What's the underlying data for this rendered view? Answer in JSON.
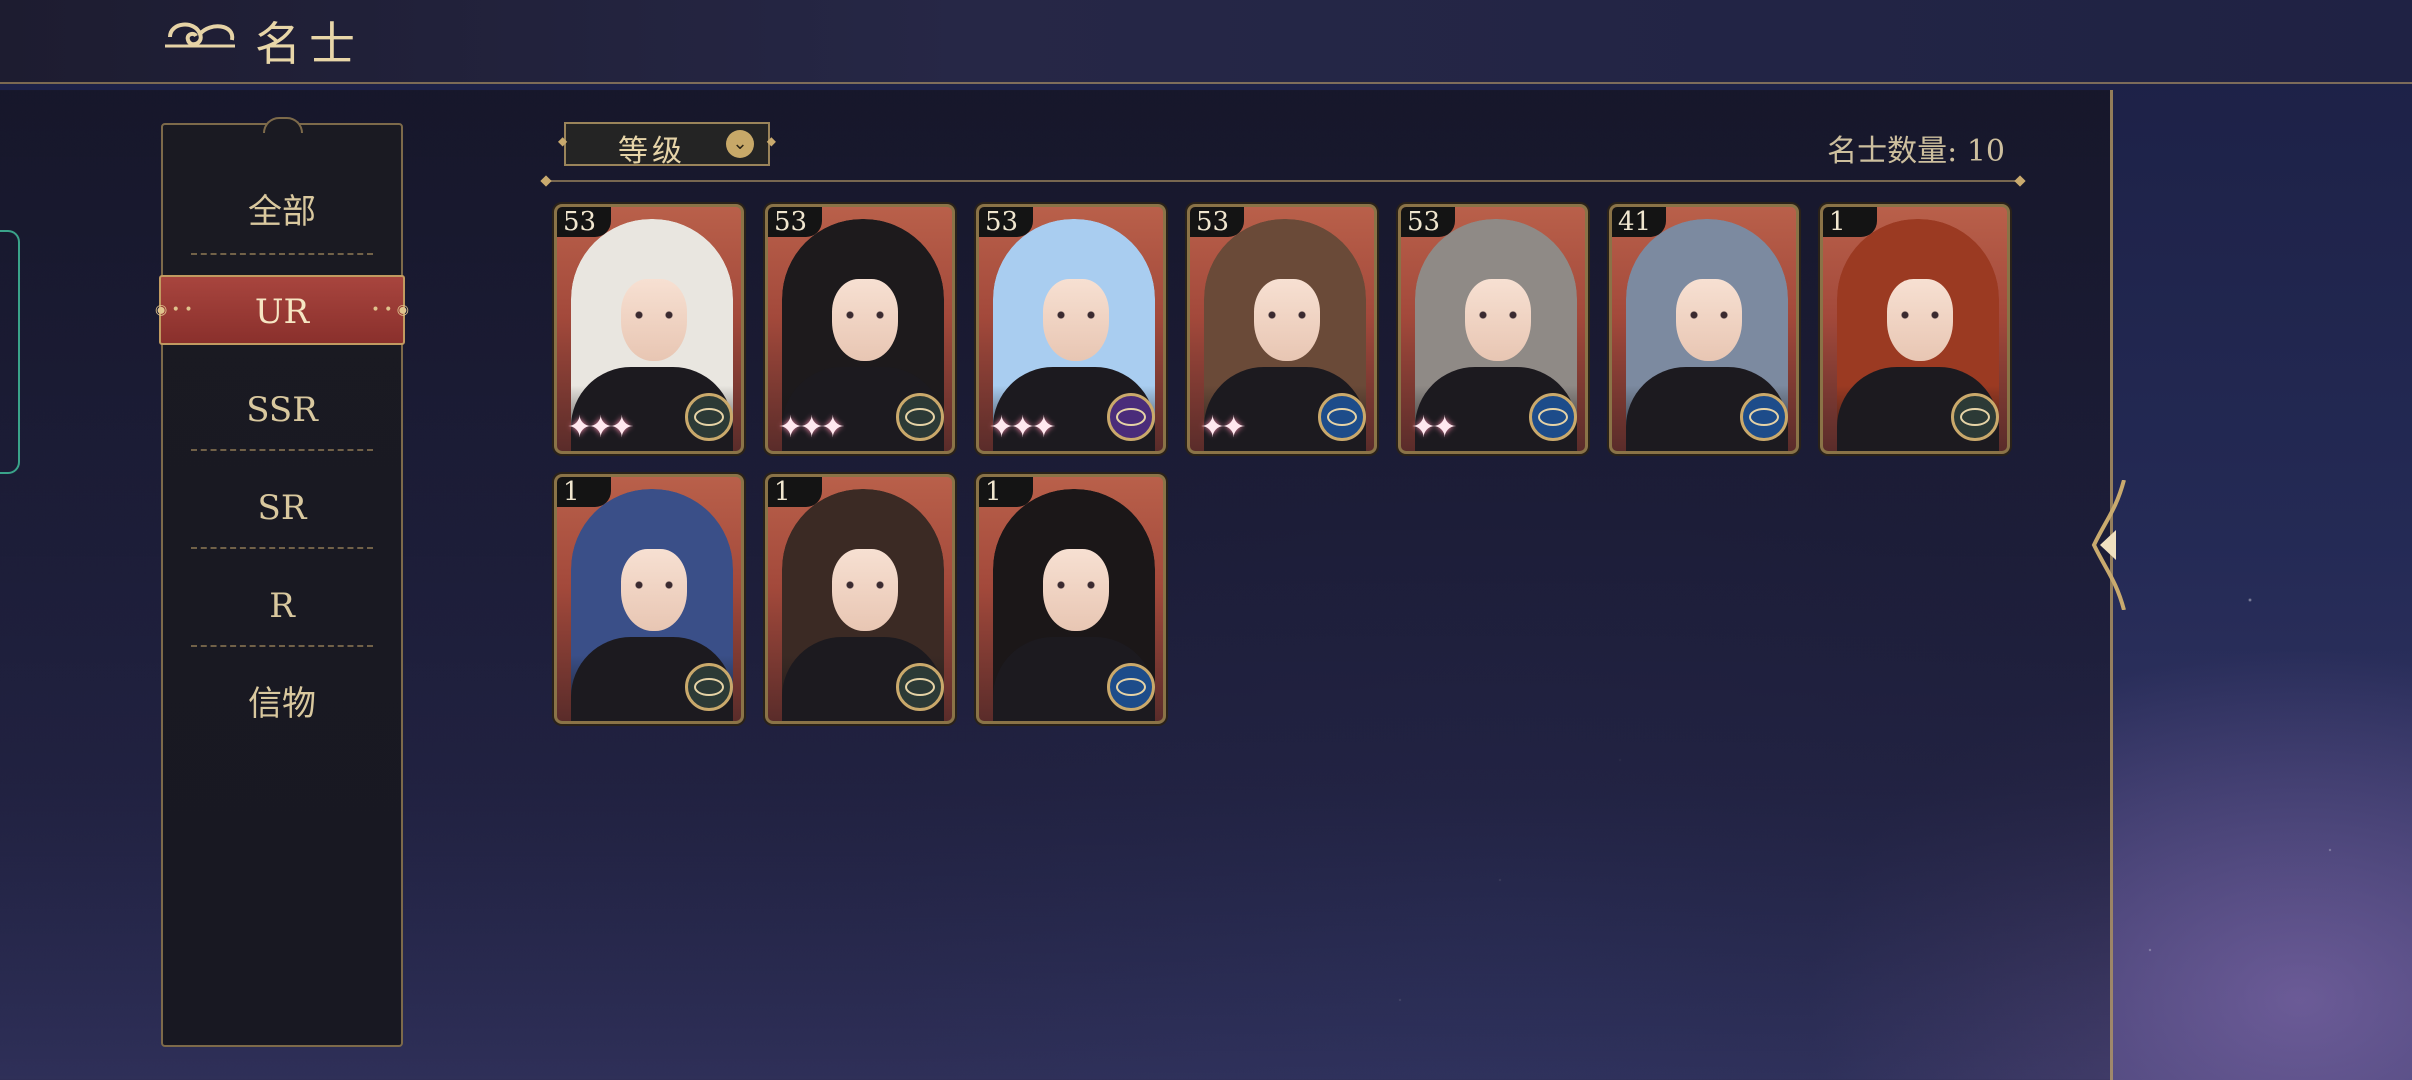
{
  "header": {
    "title": "名士"
  },
  "menu": {
    "items": [
      {
        "label": "全部",
        "active": false
      },
      {
        "label": "UR",
        "active": true
      },
      {
        "label": "SSR",
        "active": false
      },
      {
        "label": "SR",
        "active": false
      },
      {
        "label": "R",
        "active": false
      },
      {
        "label": "信物",
        "active": false
      }
    ]
  },
  "toolbar": {
    "sort_label": "等级",
    "count_text": "名士数量: 10"
  },
  "cards": [
    {
      "level": "53",
      "stars": 3,
      "icon": "compass-badge-icon",
      "icon_color": "dark",
      "hair": "#e9e6e0"
    },
    {
      "level": "53",
      "stars": 3,
      "icon": "compass-badge-icon",
      "icon_color": "dark",
      "hair": "#1d1a1c"
    },
    {
      "level": "53",
      "stars": 3,
      "icon": "orb-badge-icon",
      "icon_color": "purple",
      "hair": "#a9cdf0"
    },
    {
      "level": "53",
      "stars": 2,
      "icon": "compass-badge-icon",
      "icon_color": "blue",
      "hair": "#6a4a38"
    },
    {
      "level": "53",
      "stars": 2,
      "icon": "compass-badge-icon",
      "icon_color": "blue",
      "hair": "#8f8a86"
    },
    {
      "level": "41",
      "stars": 0,
      "icon": "compass-badge-icon",
      "icon_color": "blue",
      "hair": "#7c8aa0"
    },
    {
      "level": "1",
      "stars": 0,
      "icon": "compass-badge-icon",
      "icon_color": "dark",
      "hair": "#9b3a22"
    },
    {
      "level": "1",
      "stars": 0,
      "icon": "compass-badge-icon",
      "icon_color": "dark",
      "hair": "#3a4f88"
    },
    {
      "level": "1",
      "stars": 0,
      "icon": "compass-badge-icon",
      "icon_color": "dark",
      "hair": "#3b2a24"
    },
    {
      "level": "1",
      "stars": 0,
      "icon": "compass-badge-icon",
      "icon_color": "blue",
      "hair": "#1b1718"
    }
  ],
  "colors": {
    "accent_gold": "#c9aa6e",
    "active_red": "#9a3a34",
    "card_bg": "#a3493b"
  }
}
